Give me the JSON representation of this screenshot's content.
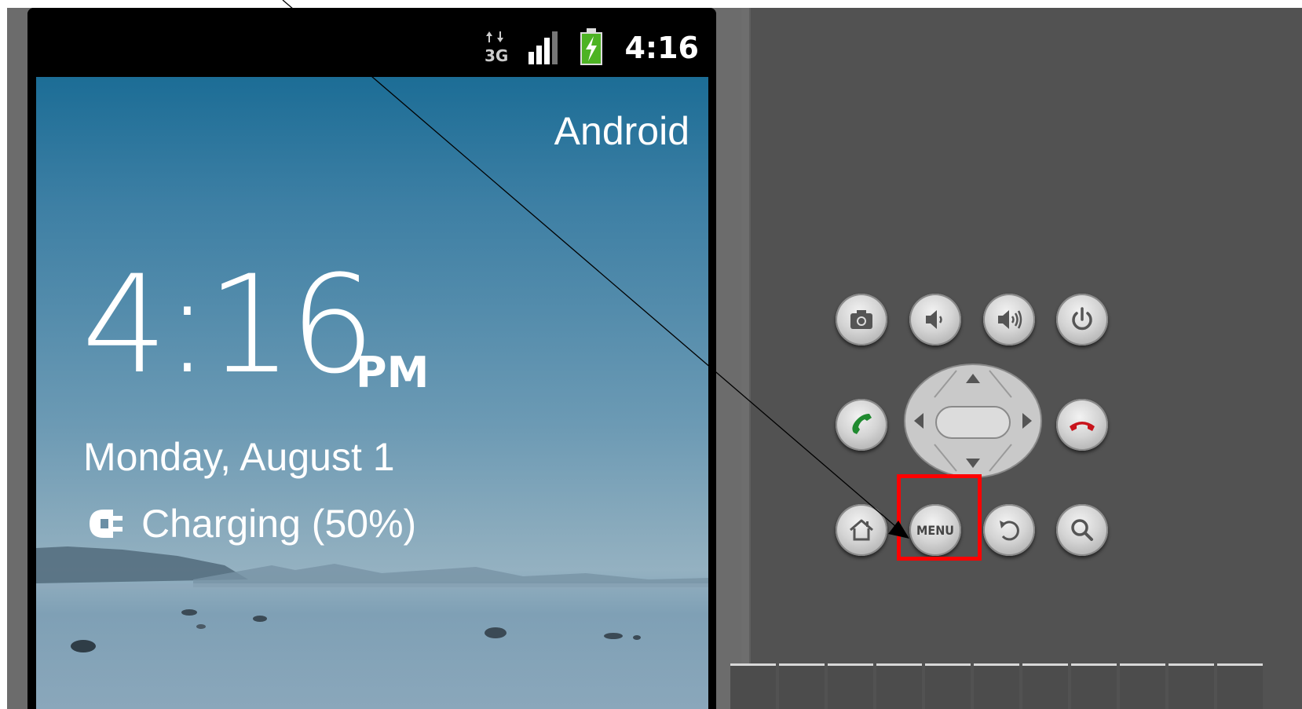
{
  "status_bar": {
    "time": "4:16",
    "network_type": "3G",
    "icons": [
      "data-3g-icon",
      "signal-strength-icon",
      "battery-charging-icon"
    ]
  },
  "lockscreen": {
    "carrier": "Android",
    "clock": "4:16",
    "ampm": "PM",
    "date": "Monday, August 1",
    "charging": "Charging (50%)"
  },
  "controls": {
    "row1": [
      "camera-icon",
      "volume-down-icon",
      "volume-up-icon",
      "power-icon"
    ],
    "row2": [
      "call-icon",
      "dpad",
      "end-call-icon"
    ],
    "row3": [
      "home-icon",
      "menu-button",
      "back-icon",
      "search-icon"
    ],
    "menu_label": "MENU"
  },
  "annotation": {
    "highlighted": "menu-button",
    "highlight_color": "#ff0000"
  },
  "colors": {
    "emulator_bg": "#525252",
    "wallpaper_top": "#1c6d96",
    "accent_green": "#1f8a2f",
    "accent_red": "#c8141c"
  }
}
